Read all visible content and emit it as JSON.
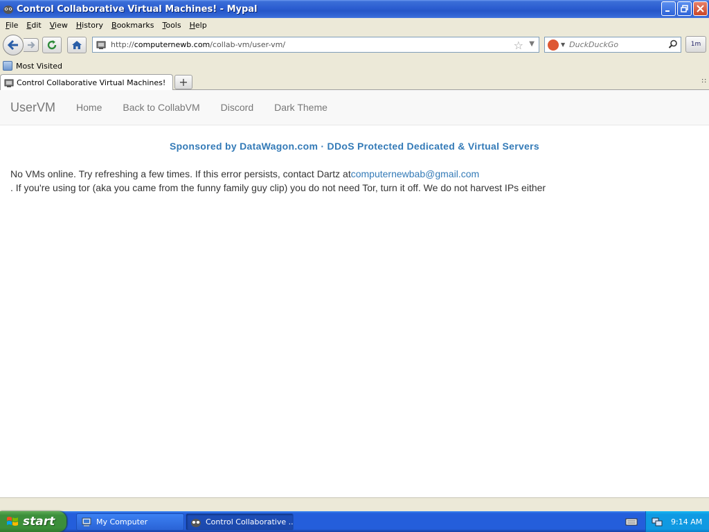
{
  "window": {
    "title": "Control Collaborative Virtual Machines! - Mypal",
    "buttons": {
      "minimize": "minimize",
      "restore": "restore",
      "close": "close"
    }
  },
  "menubar": {
    "items": [
      {
        "label": "File",
        "accel": "F",
        "rest": "ile"
      },
      {
        "label": "Edit",
        "accel": "E",
        "rest": "dit"
      },
      {
        "label": "View",
        "accel": "V",
        "rest": "iew"
      },
      {
        "label": "History",
        "accel": "H",
        "rest": "istory"
      },
      {
        "label": "Bookmarks",
        "accel": "B",
        "rest": "ookmarks"
      },
      {
        "label": "Tools",
        "accel": "T",
        "rest": "ools"
      },
      {
        "label": "Help",
        "accel": "H",
        "rest": "elp"
      }
    ]
  },
  "toolbar": {
    "url_prefix": "http://",
    "url_domain": "computernewb.com",
    "url_path": "/collab-vm/user-vm/",
    "search_placeholder": "DuckDuckGo",
    "ext_label": "1m"
  },
  "bookmarks": {
    "most_visited": "Most Visited"
  },
  "tabs": {
    "active_title": "Control Collaborative Virtual Machines!",
    "new_tab": "+",
    "list_glyph": "∷"
  },
  "page": {
    "brand": "UserVM",
    "nav": [
      "Home",
      "Back to CollabVM",
      "Discord",
      "Dark Theme"
    ],
    "sponsor": "Sponsored by DataWagon.com · DDoS Protected Dedicated & Virtual Servers",
    "message_before": "No VMs online. Try refreshing a few times. If this error persists, contact Dartz at",
    "email": "computernewbab@gmail.com",
    "message_after": ". If you're using tor (aka you came from the funny family guy clip) you do not need Tor, turn it off. We do not harvest IPs either"
  },
  "taskbar": {
    "start_label": "start",
    "tasks": [
      {
        "label": "My Computer"
      },
      {
        "label": "Control Collaborative ..."
      }
    ],
    "clock": "9:14 AM"
  },
  "colors": {
    "link": "#337ab7",
    "taskbar": "#245edb",
    "start": "#3c8f3b"
  }
}
